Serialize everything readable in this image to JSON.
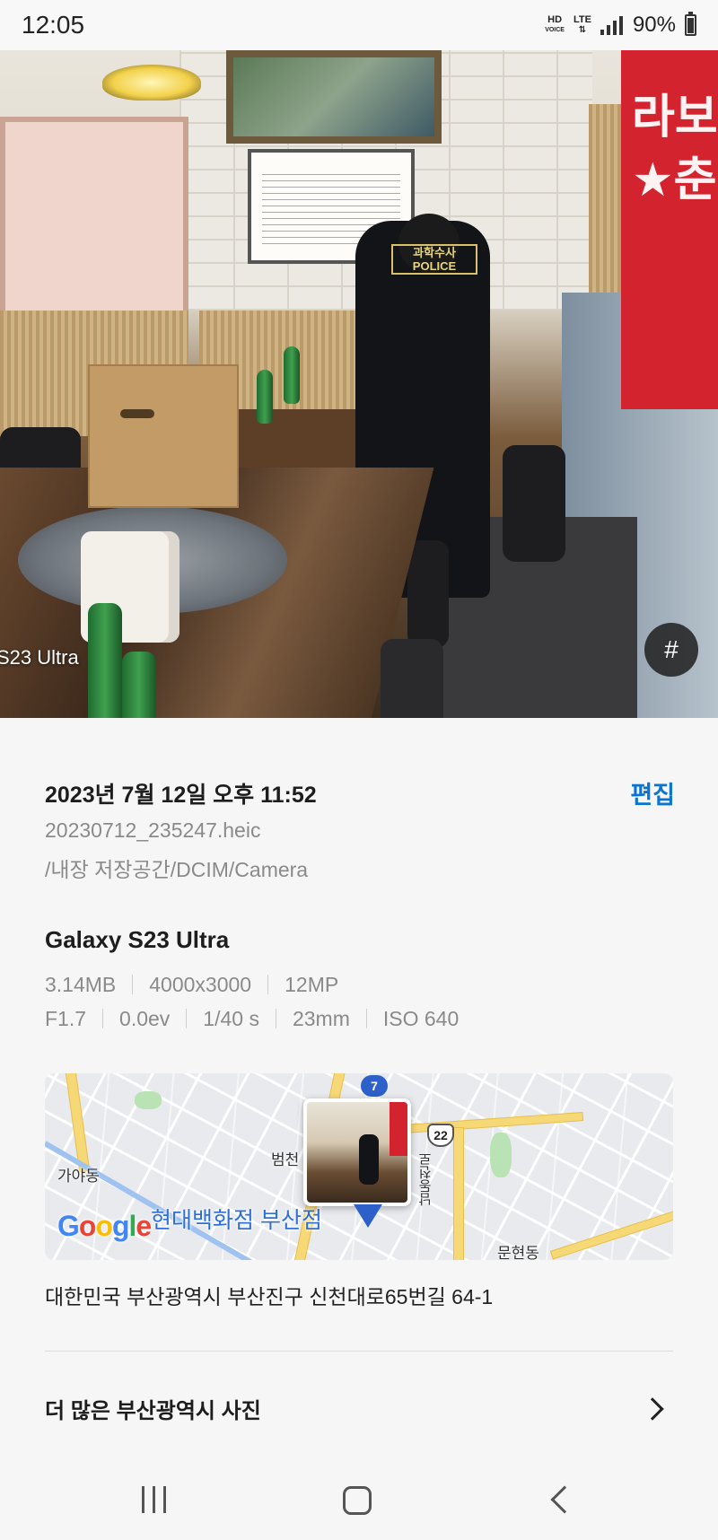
{
  "status_bar": {
    "time": "12:05",
    "hd_label": "HD",
    "voice_label": "VOICE",
    "network": "LTE",
    "battery": "90%"
  },
  "photo": {
    "watermark": "S23 Ultra",
    "tag_label": "#",
    "scene_text": {
      "banner": "라보\n★춘",
      "patch": "과학수사\nPOLICE"
    }
  },
  "details": {
    "date": "2023년 7월 12일 오후 11:52",
    "edit_label": "편집",
    "file_name": "20230712_235247.heic",
    "file_path": "/내장 저장공간/DCIM/Camera",
    "device": "Galaxy S23 Ultra",
    "specs_row1": [
      "3.14MB",
      "4000x3000",
      "12MP"
    ],
    "specs_row2": [
      "F1.7",
      "0.0ev",
      "1/40 s",
      "23mm",
      "ISO 640"
    ]
  },
  "map": {
    "labels": {
      "gaya": "가야동",
      "beomcheon": "범천",
      "munhyeon": "문현동",
      "road": "남동천로",
      "department_store": "현대백화점 부산점"
    },
    "route_7": "7",
    "route_22": "22",
    "logo": "Google",
    "logo_colors": [
      "#4285F4",
      "#EA4335",
      "#FBBC05",
      "#4285F4",
      "#34A853",
      "#EA4335"
    ]
  },
  "address": "대한민국 부산광역시 부산진구 신천대로65번길 64-1",
  "more_link": {
    "label": "더 많은 부산광역시 사진",
    "icon": "chevron-right-icon"
  },
  "nav_bar": {
    "recents_icon": "recents-icon",
    "home_icon": "home-icon",
    "back_icon": "back-icon"
  },
  "colors": {
    "accent": "#0a74d0",
    "background": "#f6f6f6"
  }
}
